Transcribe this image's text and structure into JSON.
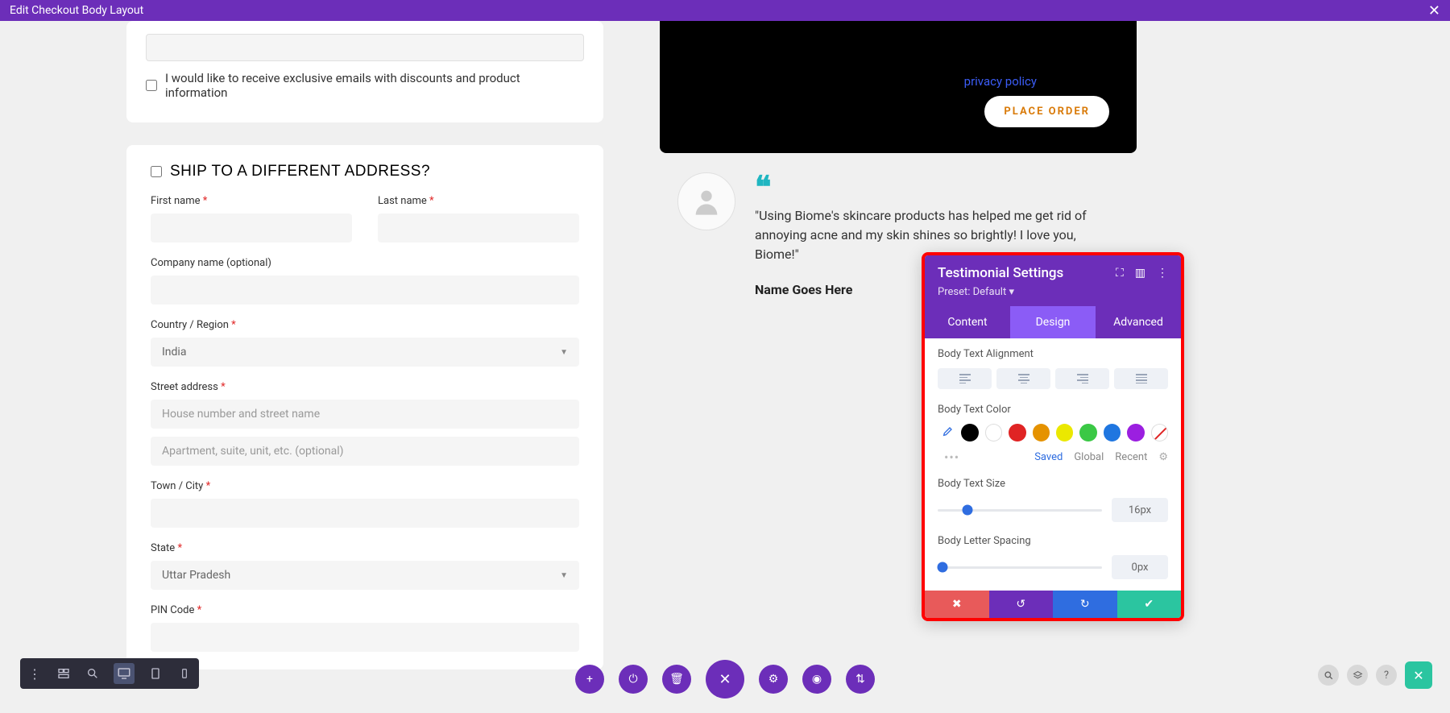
{
  "header": {
    "title": "Edit Checkout Body Layout"
  },
  "email_card": {
    "opt_in_label": "I would like to receive exclusive emails with discounts and product information"
  },
  "ship": {
    "heading": "Ship to a different address?",
    "first_name": "First name",
    "last_name": "Last name",
    "company": "Company name (optional)",
    "country": "Country / Region",
    "country_value": "India",
    "street": "Street address",
    "street_ph1": "House number and street name",
    "street_ph2": "Apartment, suite, unit, etc. (optional)",
    "town": "Town / City",
    "state": "State",
    "state_value": "Uttar Pradesh",
    "pin": "PIN Code"
  },
  "order_box": {
    "privacy": "privacy policy",
    "place_order": "PLACE ORDER"
  },
  "testimonial": {
    "quote": "\"Using Biome's skincare products has helped me get rid of annoying acne and my skin shines so brightly! I love you, Biome!\"",
    "author": "Name Goes Here"
  },
  "settings": {
    "title": "Testimonial Settings",
    "preset": "Preset: Default",
    "tabs": {
      "content": "Content",
      "design": "Design",
      "advanced": "Advanced"
    },
    "labels": {
      "alignment": "Body Text Alignment",
      "color": "Body Text Color",
      "size": "Body Text Size",
      "spacing": "Body Letter Spacing"
    },
    "color_tabs": {
      "saved": "Saved",
      "global": "Global",
      "recent": "Recent"
    },
    "swatches": [
      "#000000",
      "#ffffff",
      "#e02424",
      "#e59200",
      "#ebe800",
      "#3bc845",
      "#1f76e0",
      "#9b1fe0"
    ],
    "size_value": "16px",
    "spacing_value": "0px"
  }
}
